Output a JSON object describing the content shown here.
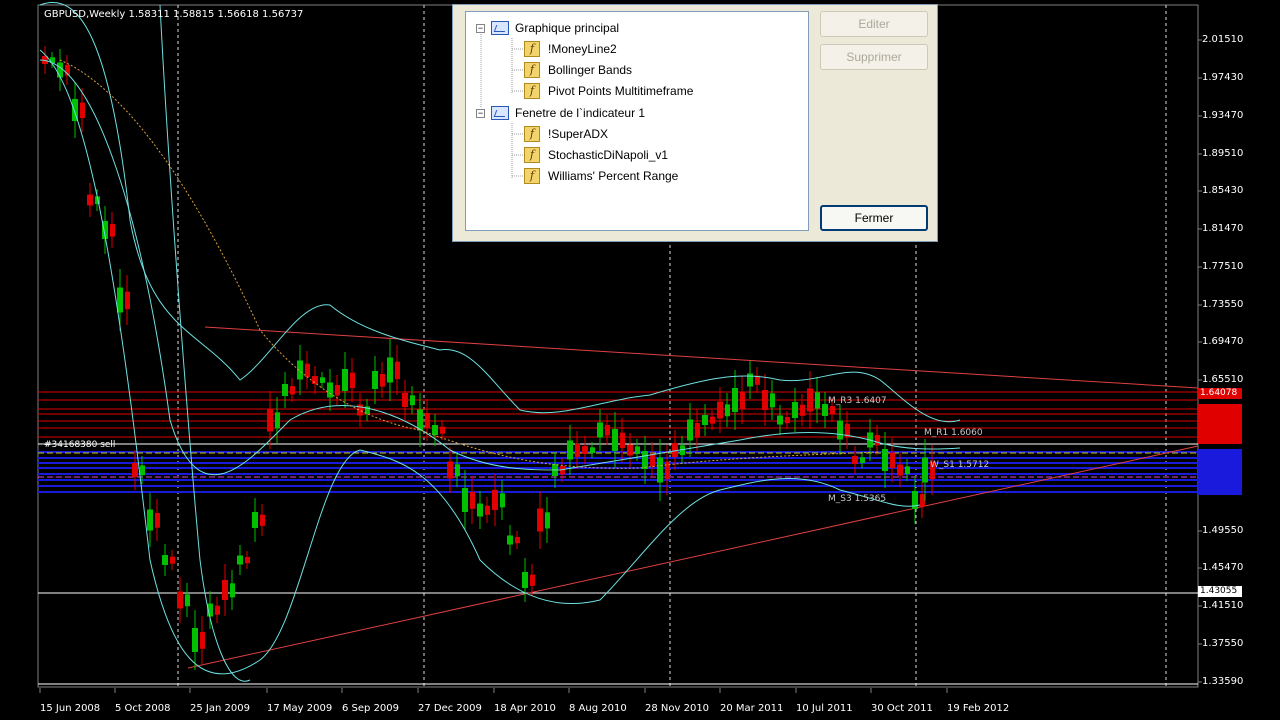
{
  "chart": {
    "header": "GBPUSD,Weekly  1.58311 1.58815 1.56618 1.56737",
    "price_axis": [
      "2.01510",
      "1.97430",
      "1.93470",
      "1.89510",
      "1.85430",
      "1.81470",
      "1.77510",
      "1.73550",
      "1.69470",
      "1.65510",
      "1.49550",
      "1.45470",
      "1.41510",
      "1.37550",
      "1.33590"
    ],
    "price_box_red": "1.64078",
    "price_box_white": "1.43055",
    "date_axis": [
      "15 Jun 2008",
      "5 Oct 2008",
      "25 Jan 2009",
      "17 May 2009",
      "6 Sep 2009",
      "27 Dec 2009",
      "18 Apr 2010",
      "8 Aug 2010",
      "28 Nov 2010",
      "20 Mar 2011",
      "10 Jul 2011",
      "30 Oct 2011",
      "19 Feb 2012"
    ],
    "order_label": "#34168380 sell",
    "pivot_labels": {
      "m_r3": "M_R3 1.6407",
      "m_r1": "M_R1 1.6060",
      "m_s3": "M_S3 1.5365",
      "w_s1": "W_S1 1.5712"
    },
    "colors": {
      "bull": "#00c000",
      "bear": "#e00000",
      "band": "#6fe0e0",
      "trend": "#e04040",
      "blue_zone": "#1a1adc"
    }
  },
  "dialog": {
    "tree": [
      {
        "label": "Graphique principal",
        "type": "group",
        "expander": "−"
      },
      {
        "label": "!MoneyLine2",
        "type": "indicator"
      },
      {
        "label": "Bollinger Bands",
        "type": "indicator"
      },
      {
        "label": "Pivot Points Multitimeframe",
        "type": "indicator"
      },
      {
        "label": "Fenetre de l`indicateur 1",
        "type": "group",
        "expander": "−"
      },
      {
        "label": "!SuperADX",
        "type": "indicator"
      },
      {
        "label": "StochasticDiNapoli_v1",
        "type": "indicator"
      },
      {
        "label": "Williams' Percent Range",
        "type": "indicator"
      }
    ],
    "buttons": {
      "edit": "Editer",
      "delete": "Supprimer",
      "close": "Fermer"
    },
    "icons": {
      "fx": "f"
    }
  }
}
